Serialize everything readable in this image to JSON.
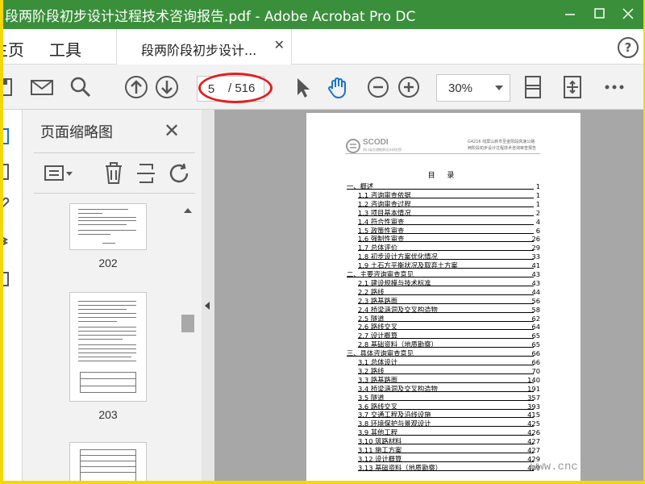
{
  "window": {
    "title": "段两阶段初步设计过程技术咨询报告.pdf - Adobe Acrobat Pro DC",
    "minimize_icon": "minimize-icon",
    "maximize_icon": "maximize-icon",
    "close_icon": "close-icon"
  },
  "tabs": {
    "home_label": "主页",
    "tools_label": "工具",
    "document_label": "段两阶段初步设计...",
    "help_label": "?"
  },
  "toolbar": {
    "current_page": "5",
    "total_pages": "/ 516",
    "zoom": "30%",
    "icons": [
      "save-icon",
      "email-icon",
      "search-icon",
      "prev-page-icon",
      "next-page-icon",
      "select-arrow-icon",
      "hand-icon",
      "zoom-out-icon",
      "zoom-in-icon",
      "fit-page-icon",
      "scroll-mode-icon",
      "more-icon"
    ]
  },
  "thumb_panel": {
    "title": "页面缩略图",
    "pages": [
      "202",
      "203"
    ]
  },
  "document": {
    "header_line1": "G4216 线屏山新市至金阳段高速公路",
    "header_line2": "两阶段初步设计过程技术咨询审查报告",
    "logo_text": "SCODI",
    "logo_subtitle": "四川省交通勘察设计研究院",
    "toc_title": "目 录",
    "toc": [
      {
        "text": "一、概述",
        "page": "1",
        "indent": 0
      },
      {
        "text": "1.1 咨询审查依据",
        "page": "1",
        "indent": 1
      },
      {
        "text": "1.2 咨询审查过程",
        "page": "1",
        "indent": 1
      },
      {
        "text": "1.3 项目基本情况",
        "page": "2",
        "indent": 1
      },
      {
        "text": "1.4 符合性审查",
        "page": "4",
        "indent": 1
      },
      {
        "text": "1.5 政策性审查",
        "page": "6",
        "indent": 1
      },
      {
        "text": "1.6 强制性审查",
        "page": "26",
        "indent": 1
      },
      {
        "text": "1.7 总体评价",
        "page": "29",
        "indent": 1
      },
      {
        "text": "1.8 初步设计方案优化情况",
        "page": "33",
        "indent": 1
      },
      {
        "text": "1.9 土石方平衡状况及取弃土方案",
        "page": "41",
        "indent": 1
      },
      {
        "text": "二、主要咨询审查意见",
        "page": "43",
        "indent": 0
      },
      {
        "text": "2.1 建设规模与技术标准",
        "page": "43",
        "indent": 1
      },
      {
        "text": "2.2 路线",
        "page": "44",
        "indent": 1
      },
      {
        "text": "2.3 路基路面",
        "page": "56",
        "indent": 1
      },
      {
        "text": "2.4 桥梁涵洞及交叉构造物",
        "page": "58",
        "indent": 1
      },
      {
        "text": "2.5 隧道",
        "page": "62",
        "indent": 1
      },
      {
        "text": "2.6 路线交叉",
        "page": "64",
        "indent": 1
      },
      {
        "text": "2.7 设计概算",
        "page": "65",
        "indent": 1
      },
      {
        "text": "2.8 基础资料（地质勘察）",
        "page": "65",
        "indent": 1
      },
      {
        "text": "三、具体咨询审查意见",
        "page": "66",
        "indent": 0
      },
      {
        "text": "3.1 总体设计",
        "page": "66",
        "indent": 1
      },
      {
        "text": "3.2 路线",
        "page": "70",
        "indent": 1
      },
      {
        "text": "3.3 路基路面",
        "page": "140",
        "indent": 1
      },
      {
        "text": "3.4 桥梁涵洞及交叉构造物",
        "page": "191",
        "indent": 1
      },
      {
        "text": "3.5 隧道",
        "page": "357",
        "indent": 1
      },
      {
        "text": "3.6 路线交叉",
        "page": "393",
        "indent": 1
      },
      {
        "text": "3.7 交通工程及沿线设施",
        "page": "415",
        "indent": 1
      },
      {
        "text": "3.8 环境保护与景观设计",
        "page": "425",
        "indent": 1
      },
      {
        "text": "3.9 其他工程",
        "page": "426",
        "indent": 1
      },
      {
        "text": "3.10 筑路材料",
        "page": "427",
        "indent": 1
      },
      {
        "text": "3.11 施工方案",
        "page": "427",
        "indent": 1
      },
      {
        "text": "3.12 设计概算",
        "page": "429",
        "indent": 1
      },
      {
        "text": "3.13 基础资料（地质勘察）",
        "page": "429",
        "indent": 1
      }
    ]
  },
  "watermark": "www.cnc",
  "colors": {
    "titlebar": "#3a8f3a",
    "frame": "#f5d800",
    "annotation": "#e02020",
    "hand_tool": "#1a73c8"
  }
}
